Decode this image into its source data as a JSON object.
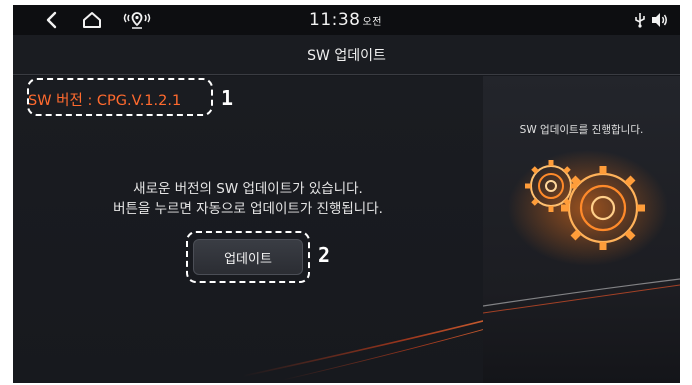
{
  "status_bar": {
    "time": "11:38",
    "ampm": "오전",
    "icons": [
      "back-icon",
      "home-icon",
      "location-icon",
      "usb-icon",
      "volume-icon"
    ]
  },
  "title_bar": {
    "title": "SW 업데이트"
  },
  "left_panel": {
    "version": "SW 버전 : CPG.V.1.2.1",
    "callout_1": "1",
    "message_line1": "새로운 버전의 SW 업데이트가 있습니다.",
    "message_line2": "버튼을 누르면 자동으로 업데이트가 진행됩니다.",
    "update_button": "업데이트",
    "callout_2": "2"
  },
  "right_panel": {
    "caption": "SW 업데이트를 진행합니다.",
    "image": "gears-illustration"
  },
  "colors": {
    "accent": "#ff6a2e",
    "background": "#16181d",
    "status_bar": "#0d0e11"
  }
}
